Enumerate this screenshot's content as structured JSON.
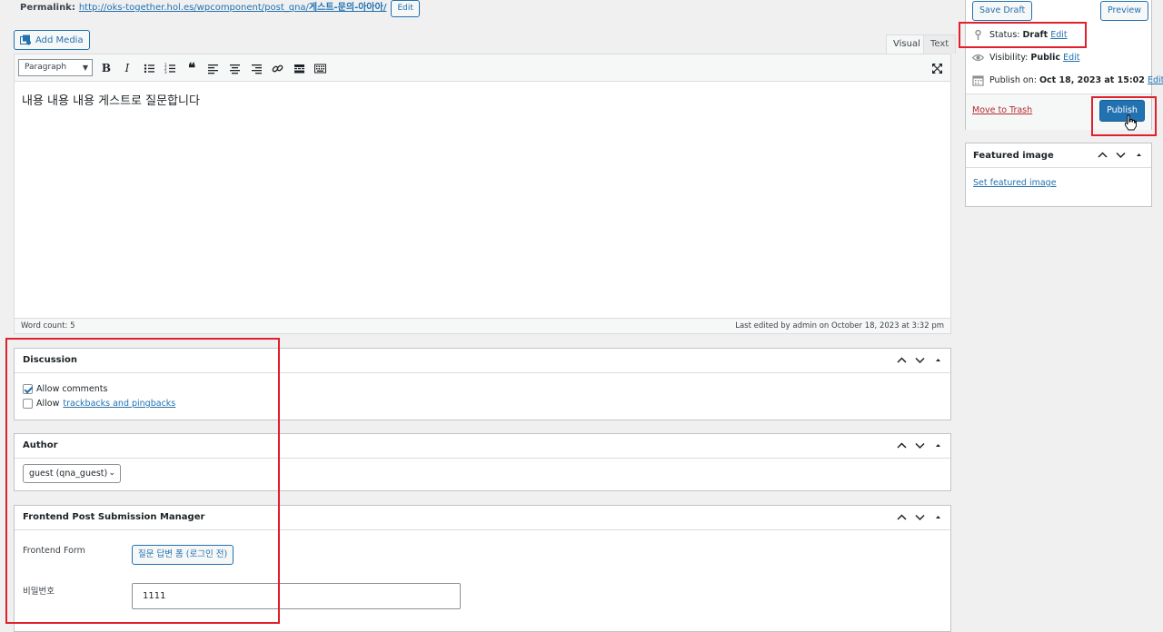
{
  "permalink": {
    "label": "Permalink:",
    "url_base": "http://oks-together.hol.es/wpcomponent/post_qna/",
    "url_slug": "게스트-문의-아아아/",
    "edit_label": "Edit"
  },
  "editor": {
    "add_media_label": "Add Media",
    "tab_visual": "Visual",
    "tab_text": "Text",
    "format_value": "Paragraph",
    "content": "내용 내용 내용 게스트로 질문합니다",
    "word_count": "Word count: 5",
    "last_edited": "Last edited by admin on October 18, 2023 at 3:32 pm",
    "toolbar_icons": [
      "bold-icon",
      "italic-icon",
      "bulleted-list-icon",
      "numbered-list-icon",
      "blockquote-icon",
      "align-left-icon",
      "align-center-icon",
      "align-right-icon",
      "link-icon",
      "read-more-icon",
      "toolbar-toggle-icon",
      "fullscreen-icon"
    ]
  },
  "discussion": {
    "title": "Discussion",
    "allow_comments_label": "Allow comments",
    "allow_comments_checked": true,
    "allow_prefix": "Allow",
    "trackbacks_link": "trackbacks and pingbacks",
    "trackbacks_checked": false
  },
  "author": {
    "title": "Author",
    "selected": "guest (qna_guest)"
  },
  "fpsm": {
    "title": "Frontend Post Submission Manager",
    "form_label": "Frontend Form",
    "form_button": "질문 답변 폼 (로그인 전)",
    "password_label": "비밀번호",
    "password_value": "1111"
  },
  "publish": {
    "save_draft": "Save Draft",
    "preview": "Preview",
    "status_label": "Status:",
    "status_value": "Draft",
    "visibility_label": "Visibility:",
    "visibility_value": "Public",
    "publish_on_label": "Publish on:",
    "publish_on_value": "Oct 18, 2023 at 15:02",
    "edit_label": "Edit",
    "move_to_trash": "Move to Trash",
    "publish_button": "Publish"
  },
  "featured_image": {
    "title": "Featured image",
    "set_link": "Set featured image"
  },
  "colors": {
    "accent": "#2271b1",
    "annotation_red": "#e0202a",
    "trash_red": "#b32d2e"
  }
}
